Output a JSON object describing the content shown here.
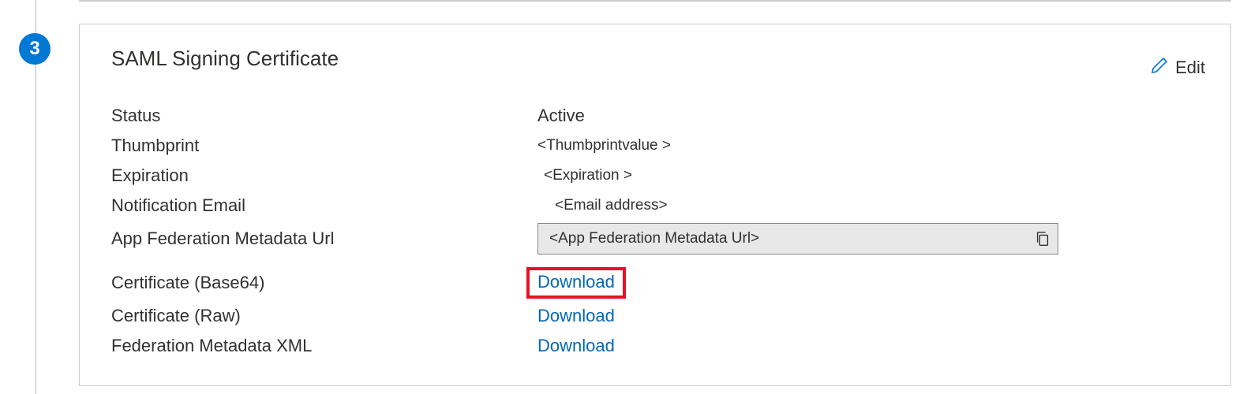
{
  "step": {
    "number": "3"
  },
  "card": {
    "title": "SAML Signing Certificate",
    "edit_label": "Edit"
  },
  "fields": {
    "status": {
      "label": "Status",
      "value": "Active"
    },
    "thumbprint": {
      "label": "Thumbprint",
      "value": "<Thumbprintvalue >"
    },
    "expiration": {
      "label": "Expiration",
      "value": "<Expiration >"
    },
    "notification_email": {
      "label": "Notification Email",
      "value": "<Email address>"
    },
    "metadata_url": {
      "label": "App Federation Metadata Url",
      "value": "<App Federation  Metadata Url>"
    },
    "cert_base64": {
      "label": "Certificate (Base64)",
      "action": "Download"
    },
    "cert_raw": {
      "label": "Certificate (Raw)",
      "action": "Download"
    },
    "federation_xml": {
      "label": "Federation Metadata XML",
      "action": "Download"
    }
  }
}
